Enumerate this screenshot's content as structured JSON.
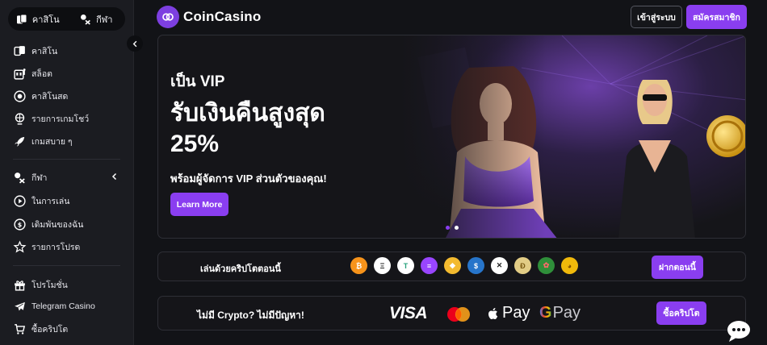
{
  "sidebar": {
    "segment": [
      {
        "label": "คาสิโน",
        "icon": "cards-icon"
      },
      {
        "label": "กีฬา",
        "icon": "sports-icon"
      }
    ],
    "items": [
      {
        "label": "คาสิโน",
        "icon": "cards-icon"
      },
      {
        "label": "สล็อต",
        "icon": "slot-machine-icon"
      },
      {
        "label": "คาสิโนสด",
        "icon": "live-chip-icon"
      },
      {
        "label": "รายการเกมโชว์",
        "icon": "game-show-icon"
      },
      {
        "label": "เกมสบาย ๆ",
        "icon": "rocket-icon"
      },
      {
        "label": "กีฬา",
        "icon": "sports-icon"
      },
      {
        "label": "ในการเล่น",
        "icon": "play-circle-icon"
      },
      {
        "label": "เดิมพันของฉัน",
        "icon": "coin-bet-icon"
      },
      {
        "label": "รายการโปรด",
        "icon": "star-icon"
      },
      {
        "label": "โปรโมชั่น",
        "icon": "gift-icon"
      },
      {
        "label": "Telegram Casino",
        "icon": "telegram-icon"
      },
      {
        "label": "ซื้อคริปโต",
        "icon": "buy-crypto-icon"
      }
    ]
  },
  "header": {
    "logo": "CoinCasino",
    "login": "เข้าสู่ระบบ",
    "signup": "สมัครสมาชิก"
  },
  "hero": {
    "kicker": "เป็น VIP",
    "title_line1": "รับเงินคืนสูงสุด",
    "title_line2": "25%",
    "subtitle": "พร้อมผู้จัดการ VIP ส่วนตัวของคุณ!",
    "cta": "Learn More",
    "slides": 2,
    "active_slide": 1
  },
  "crypto": {
    "label": "เล่นด้วยคริปโตตอนนี้",
    "coins": [
      {
        "name": "bitcoin",
        "symbol": "₿",
        "color": "#f7931a"
      },
      {
        "name": "ethereum",
        "symbol": "Ξ",
        "color": "#ffffff"
      },
      {
        "name": "tether",
        "symbol": "T",
        "color": "#26a17b"
      },
      {
        "name": "solana",
        "symbol": "≡",
        "color": "#9945ff"
      },
      {
        "name": "bnb",
        "symbol": "◆",
        "color": "#f3ba2f"
      },
      {
        "name": "usd-coin",
        "symbol": "$",
        "color": "#2775ca"
      },
      {
        "name": "xrp",
        "symbol": "✕",
        "color": "#ffffff"
      },
      {
        "name": "dogecoin",
        "symbol": "Ð",
        "color": "#c2a633"
      },
      {
        "name": "rose-token",
        "symbol": "✿",
        "color": "#2f8f3a"
      },
      {
        "name": "doge-meme",
        "symbol": "◕",
        "color": "#f0b90b"
      }
    ],
    "button": "ฝากตอนนี้"
  },
  "fiat": {
    "label": "ไม่มี Crypto? ไม่มีปัญหา!",
    "visa": "VISA",
    "apple": "Pay",
    "google_g": "G",
    "google": "Pay",
    "button": "ซื้อคริปโต"
  },
  "colors": {
    "accent": "#8a3ef0",
    "bg": "#121317",
    "sidebar": "#1b1c21",
    "card": "#151519"
  }
}
